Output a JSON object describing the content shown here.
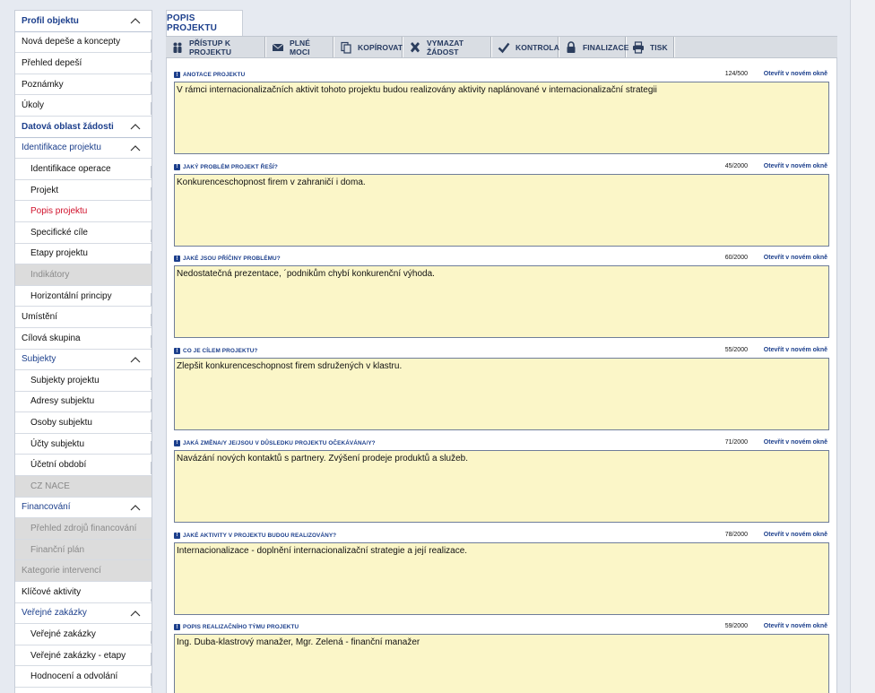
{
  "sidebar": {
    "items": [
      {
        "label": "Profil objektu",
        "type": "header",
        "chevron": "up"
      },
      {
        "label": "Nová depeše a koncepty",
        "type": "plain"
      },
      {
        "label": "Přehled depeší",
        "type": "plain"
      },
      {
        "label": "Poznámky",
        "type": "plain"
      },
      {
        "label": "Úkoly",
        "type": "plain"
      },
      {
        "label": "Datová oblast žádosti",
        "type": "header",
        "chevron": "up"
      },
      {
        "label": "Identifikace projektu",
        "type": "level1",
        "chevron": "up"
      },
      {
        "label": "Identifikace operace",
        "type": "sub"
      },
      {
        "label": "Projekt",
        "type": "sub"
      },
      {
        "label": "Popis projektu",
        "type": "sub",
        "state": "active"
      },
      {
        "label": "Specifické cíle",
        "type": "sub"
      },
      {
        "label": "Etapy projektu",
        "type": "sub"
      },
      {
        "label": "Indikátory",
        "type": "sub",
        "state": "disabled"
      },
      {
        "label": "Horizontální principy",
        "type": "sub"
      },
      {
        "label": "Umístění",
        "type": "plain"
      },
      {
        "label": "Cílová skupina",
        "type": "plain"
      },
      {
        "label": "Subjekty",
        "type": "level1",
        "chevron": "up"
      },
      {
        "label": "Subjekty projektu",
        "type": "sub"
      },
      {
        "label": "Adresy subjektu",
        "type": "sub"
      },
      {
        "label": "Osoby subjektu",
        "type": "sub"
      },
      {
        "label": "Účty subjektu",
        "type": "sub"
      },
      {
        "label": "Účetní období",
        "type": "sub"
      },
      {
        "label": "CZ NACE",
        "type": "sub",
        "state": "disabled"
      },
      {
        "label": "Financování",
        "type": "level1",
        "chevron": "up"
      },
      {
        "label": "Přehled zdrojů financování",
        "type": "sub",
        "state": "disabled"
      },
      {
        "label": "Finanční plán",
        "type": "sub",
        "state": "disabled"
      },
      {
        "label": "Kategorie intervencí",
        "type": "plain",
        "state": "disabled"
      },
      {
        "label": "Klíčové aktivity",
        "type": "plain"
      },
      {
        "label": "Veřejné zakázky",
        "type": "level1",
        "chevron": "up"
      },
      {
        "label": "Veřejné zakázky",
        "type": "sub"
      },
      {
        "label": "Veřejné zakázky - etapy",
        "type": "sub"
      },
      {
        "label": "Hodnocení a odvolání",
        "type": "sub"
      }
    ]
  },
  "tab": {
    "label": "POPIS PROJEKTU"
  },
  "toolbar": {
    "buttons": [
      {
        "label": "PŘÍSTUP K PROJEKTU",
        "icon": "people-icon",
        "name": "access-button"
      },
      {
        "label": "PLNÉ MOCI",
        "icon": "envelope-icon",
        "name": "power-of-attorney-button"
      },
      {
        "label": "KOPÍROVAT",
        "icon": "copy-icon",
        "name": "copy-button"
      },
      {
        "label": "VYMAZAT ŽÁDOST",
        "icon": "cross-icon",
        "name": "delete-request-button"
      },
      {
        "label": "KONTROLA",
        "icon": "check-icon",
        "name": "check-button"
      },
      {
        "label": "FINALIZACE",
        "icon": "lock-icon",
        "name": "finalize-button"
      },
      {
        "label": "TISK",
        "icon": "printer-icon",
        "name": "print-button"
      }
    ]
  },
  "fields": [
    {
      "label": "ANOTACE PROJEKTU",
      "count": "124/500",
      "link": "Otevřít v novém okně",
      "value": "V rámci internacionalizačních aktivit tohoto projektu budou realizovány aktivity naplánované v internacionalizační strategii"
    },
    {
      "label": "JAKÝ PROBLÉM PROJEKT ŘEŠÍ?",
      "count": "45/2000",
      "link": "Otevřít v novém okně",
      "value": "Konkurenceschopnost firem v zahraničí i doma."
    },
    {
      "label": "JAKÉ JSOU PŘÍČINY PROBLÉMU?",
      "count": "60/2000",
      "link": "Otevřít v novém okně",
      "value": "Nedostatečná prezentace, ´podnikům chybí konkurenční výhoda."
    },
    {
      "label": "CO JE CÍLEM PROJEKTU?",
      "count": "55/2000",
      "link": "Otevřít v novém okně",
      "value": "Zlepšit konkurenceschopnost firem sdružených v klastru."
    },
    {
      "label": "JAKÁ ZMĚNA/Y JE/JSOU V DŮSLEDKU PROJEKTU OČEKÁVÁNA/Y?",
      "count": "71/2000",
      "link": "Otevřít v novém okně",
      "value": "Navázání nových kontaktů s partnery. Zvýšení prodeje produktů a služeb."
    },
    {
      "label": "JAKÉ AKTIVITY V PROJEKTU BUDOU REALIZOVÁNY?",
      "count": "78/2000",
      "link": "Otevřít v novém okně",
      "value": "Internacionalizace - doplnění internacionalizační strategie a její realizace."
    },
    {
      "label": "POPIS REALIZAČNÍHO TÝMU PROJEKTU",
      "count": "59/2000",
      "link": "Otevřít v novém okně",
      "value": "Ing. Duba-klastrový manažer, Mgr. Zelená - finanční manažer"
    }
  ]
}
